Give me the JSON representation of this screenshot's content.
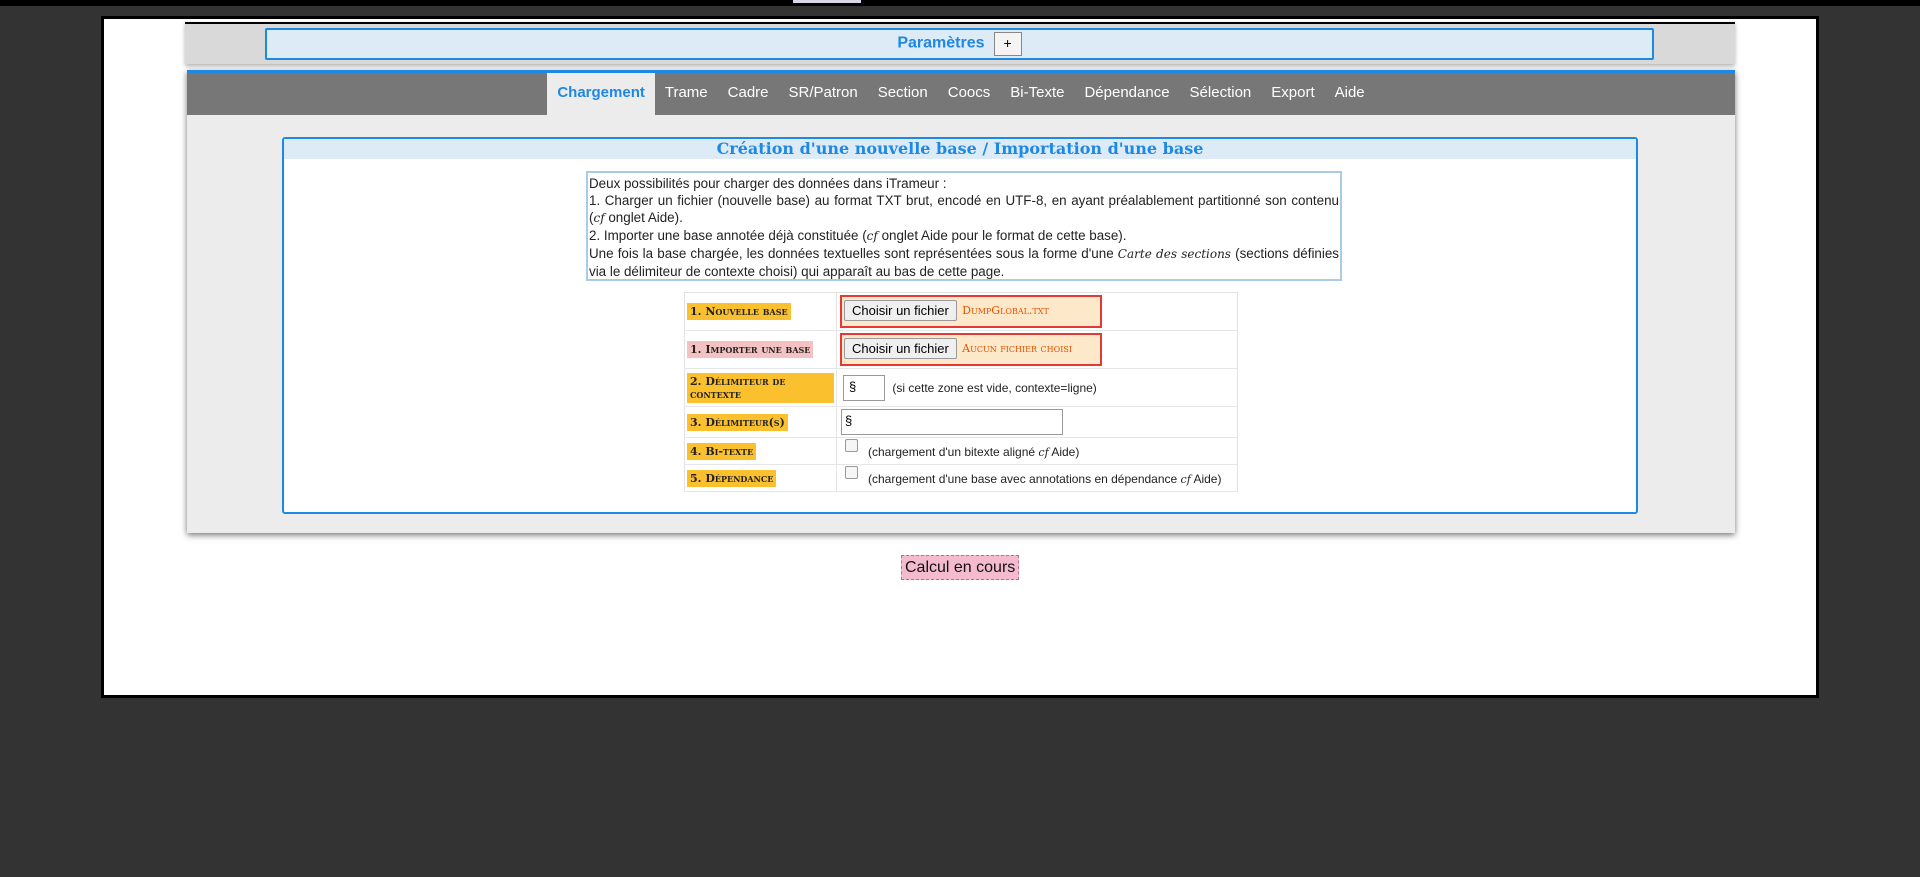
{
  "params": {
    "title": "Paramètres",
    "toggle": "+"
  },
  "tabs": [
    {
      "label": "Chargement",
      "active": true
    },
    {
      "label": "Trame"
    },
    {
      "label": "Cadre"
    },
    {
      "label": "SR/Patron"
    },
    {
      "label": "Section"
    },
    {
      "label": "Coocs"
    },
    {
      "label": "Bi-Texte"
    },
    {
      "label": "Dépendance"
    },
    {
      "label": "Sélection"
    },
    {
      "label": "Export"
    },
    {
      "label": "Aide"
    }
  ],
  "creation": {
    "title": "Création d'une nouvelle base / Importation d'une base",
    "desc": {
      "line1": "Deux possibilités pour charger des données dans iTrameur :",
      "line2_a": "1. Charger un fichier (nouvelle base) au format TXT brut, encodé en UTF-8, en ayant préalablement partitionné son contenu (",
      "cf": "cf",
      "line2_b": " onglet Aide).",
      "line3_a": "2. Importer une base annotée déjà constituée (",
      "line3_b": " onglet Aide pour le format de cette base).",
      "line4_a": "Une fois la base chargée, les données textuelles sont représentées sous la forme d'une ",
      "line4_em": "Carte des sections",
      "line4_b": " (sections définies via le délimiteur de contexte choisi) qui apparaît au bas de cette page."
    }
  },
  "form": {
    "new_base": {
      "label": "1. Nouvelle base",
      "button": "Choisir un fichier",
      "file": "DumpGlobal.txt"
    },
    "import_base": {
      "label": "1. Importer une base",
      "button": "Choisir un fichier",
      "file": "Aucun fichier choisi"
    },
    "context_delim": {
      "label": "2. Délimiteur de contexte",
      "value": "§",
      "hint": "(si cette zone est vide, contexte=ligne)"
    },
    "delims": {
      "label": "3. Délimiteur(s)",
      "value": "§"
    },
    "bitext": {
      "label": "4. Bi-texte",
      "hint_a": "(chargement d'un bitexte aligné ",
      "cf": "cf",
      "hint_b": " Aide)"
    },
    "dependance": {
      "label": "5. Dépendance",
      "hint_a": "(chargement d'une base avec annotations en dépendance ",
      "cf": "cf",
      "hint_b": " Aide)"
    }
  },
  "status": {
    "text": "Calcul en cours"
  }
}
